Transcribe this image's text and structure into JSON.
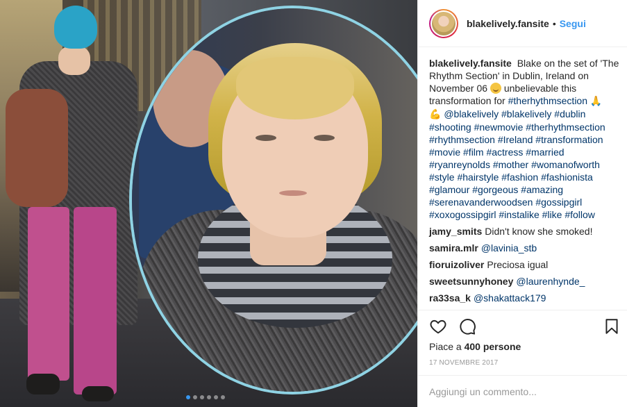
{
  "post": {
    "username": "blakelively.fansite",
    "separator": "•",
    "follow_label": "Segui",
    "caption": {
      "username": "blakelively.fansite",
      "text_1": "Blake on the set of 'The Rhythm Section' in Dublin, Ireland on November 06",
      "emoji_1": "smiling-face",
      "text_2": "unbelievable this transformation for",
      "tag_1": "#therhythmsection",
      "emoji_2": "folded-hands",
      "emoji_3": "flexed-biceps",
      "tags": "@blakelively #blakelively #dublin #shooting #newmovie #therhythmsection #rhythmsection #Ireland #transformation #movie #film #actress #married #ryanreynolds #mother #womanofworth #style #hairstyle #fashion #fashionista #glamour #gorgeous #amazing #serenavanderwoodsen #gossipgirl #xoxogossipgirl #instalike #like #follow"
    },
    "comments": [
      {
        "username": "jamy_smits",
        "text": "Didn't know she smoked!",
        "is_mention": false
      },
      {
        "username": "samira.mlr",
        "text": "@lavinia_stb",
        "is_mention": true
      },
      {
        "username": "fioruizoliver",
        "text": "Preciosa igual",
        "is_mention": false
      },
      {
        "username": "sweetsunnyhoney",
        "text": "@laurenhynde_",
        "is_mention": true
      },
      {
        "username": "ra33sa_k",
        "text": "@shakattack179",
        "is_mention": true
      }
    ],
    "likes_text_prefix": "Piace a ",
    "likes_count": "400 persone",
    "date": "17 NOVEMBRE 2017",
    "comment_placeholder": "Aggiungi un commento...",
    "carousel": {
      "total": 6,
      "active_index": 0
    }
  },
  "icons": {
    "like": "heart-icon",
    "comment": "comment-bubble-icon",
    "save": "bookmark-icon"
  },
  "colors": {
    "link_blue": "#3897f0",
    "hashtag": "#003569",
    "text": "#262626",
    "muted": "#999999",
    "circle_border": "#8fd3e4"
  }
}
